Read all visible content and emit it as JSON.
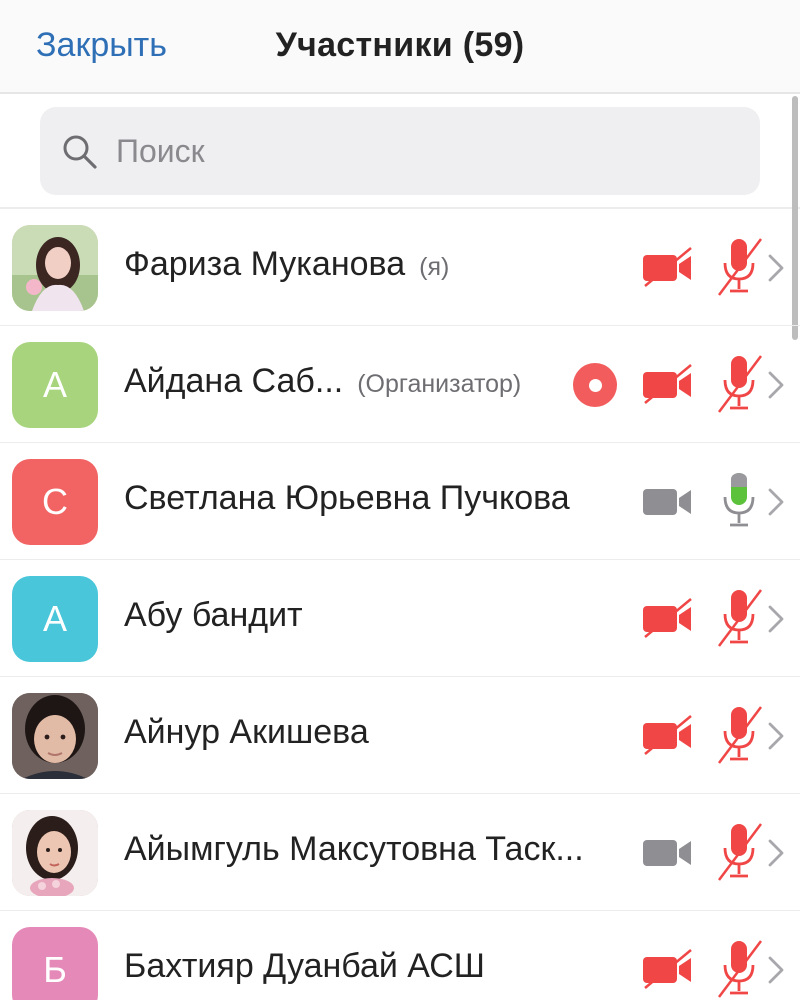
{
  "header": {
    "close_label": "Закрыть",
    "title": "Участники (59)"
  },
  "search": {
    "placeholder": "Поиск",
    "value": ""
  },
  "colors": {
    "accent": "#2e6fb6",
    "muted_red": "#f04646",
    "active_green": "#5cc23c",
    "neutral_gray": "#8e8e93"
  },
  "participants": [
    {
      "name": "Фариза Муканова",
      "role": "(я)",
      "avatar_type": "photo",
      "avatar_letter": "",
      "avatar_color": "#e9c9c6",
      "recording": false,
      "video": "off",
      "audio": "off"
    },
    {
      "name": "Айдана Саб...",
      "role": "(Организатор)",
      "avatar_type": "letter",
      "avatar_letter": "А",
      "avatar_color": "#a7d47d",
      "recording": true,
      "video": "off",
      "audio": "off"
    },
    {
      "name": "Светлана Юрьевна Пучкова",
      "role": "",
      "avatar_type": "letter",
      "avatar_letter": "С",
      "avatar_color": "#f26464",
      "recording": false,
      "video": "idle",
      "audio": "on"
    },
    {
      "name": "Абу бандит",
      "role": "",
      "avatar_type": "letter",
      "avatar_letter": "А",
      "avatar_color": "#49c6da",
      "recording": false,
      "video": "off",
      "audio": "off"
    },
    {
      "name": "Айнур Акишева",
      "role": "",
      "avatar_type": "photo",
      "avatar_letter": "",
      "avatar_color": "#6b5a55",
      "recording": false,
      "video": "off",
      "audio": "off"
    },
    {
      "name": "Айымгуль Максутовна Таск...",
      "role": "",
      "avatar_type": "photo",
      "avatar_letter": "",
      "avatar_color": "#c9a99e",
      "recording": false,
      "video": "idle",
      "audio": "off"
    },
    {
      "name": "Бахтияр Дуанбай АСШ",
      "role": "",
      "avatar_type": "letter",
      "avatar_letter": "Б",
      "avatar_color": "#e489b8",
      "recording": false,
      "video": "off",
      "audio": "off"
    }
  ]
}
